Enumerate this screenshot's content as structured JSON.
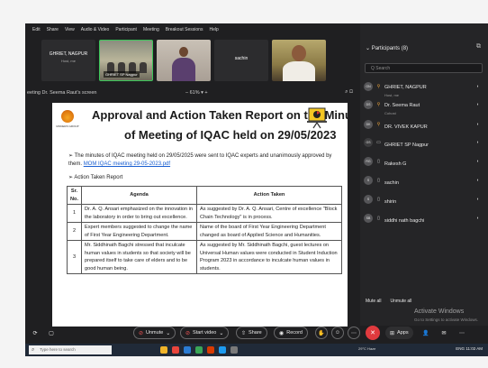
{
  "menu": [
    "Edit",
    "Share",
    "View",
    "Audio & Video",
    "Participant",
    "Meeting",
    "Breakout Sessions",
    "Help"
  ],
  "tiles": [
    {
      "name": "GHRIET, NAGPUR",
      "sub": "Host, me"
    },
    {
      "tag": "GHRIET SP Nagpur"
    },
    {},
    {
      "name": "sachin"
    },
    {}
  ],
  "sharebar": {
    "who": "eeting Dr. Seema Raut's screen",
    "zoom": "61%"
  },
  "document": {
    "logo_text": "MODERN GROUP",
    "title_line1": "Approval and Action Taken Report on the Minutes",
    "title_line2": "of Meeting of IQAC held on 29/05/2023",
    "paragraph": "The minutes of IQAC meeting held on 29/05/2025 were sent to IQAC experts and unanimously approved by them.",
    "link": "MOM IQAC meeting 29-05-2023.pdf",
    "section": "Action Taken Report",
    "table": {
      "headers": [
        "Sr. No.",
        "Agenda",
        "Action Taken"
      ],
      "rows": [
        {
          "no": "1",
          "agenda": "Dr. A. Q. Ansari emphasized on the innovation in the laboratory in order to bring out excellence.",
          "action": "As suggested by Dr. A. Q. Ansari, Centre of excellence \"Block Chain Technology\" is in process."
        },
        {
          "no": "2",
          "agenda": "Expert members suggested to change the name of First Year Engineering Department.",
          "action": "Name of the board of First Year Engineering Department changed as board of Applied Science and Humanities."
        },
        {
          "no": "3",
          "agenda": "Mr. Siddhinath Bagchi stressed that inculcate human values in students so that society will be prepared itself to take care of elders and to be good human being.",
          "action": "As suggested by Mr. Siddhinath Bagchi, guest lectures on Universal Human values were conducted in Student Induction Program 2023 in accordance to inculcate human values in students."
        }
      ]
    }
  },
  "participants": {
    "header": "Participants (8)",
    "search_placeholder": "Q Search",
    "list": [
      {
        "initials": "GN",
        "name": "GHRIET, NAGPUR",
        "sub": "Host, me"
      },
      {
        "initials": "DS",
        "name": "Dr. Seema Raut",
        "sub": "Cohost"
      },
      {
        "initials": "DK",
        "name": "DR. VIVEK KAPUR",
        "sub": ""
      },
      {
        "initials": "GS",
        "name": "GHRIET SP Nagpur",
        "sub": ""
      },
      {
        "initials": "RG",
        "name": "Rakesh G",
        "sub": ""
      },
      {
        "initials": "S",
        "name": "sachin",
        "sub": ""
      },
      {
        "initials": "S",
        "name": "shirin",
        "sub": ""
      },
      {
        "initials": "SB",
        "name": "siddhi nath bagchi",
        "sub": ""
      }
    ],
    "mute_all": "Mute all",
    "unmute_all": "Unmute all"
  },
  "watermark": {
    "line1": "Activate Windows",
    "line2": "Go to Settings to activate Windows."
  },
  "toolbar": {
    "unmute": "Unmute",
    "start_video": "Start video",
    "share": "Share",
    "record": "Record",
    "apps": "Apps"
  },
  "taskbar": {
    "search_placeholder": "Type here to search",
    "weather": "29°C Haze",
    "lang": "ENG",
    "time": "11:02 AM"
  },
  "colors": {
    "accent_red": "#e03a3e",
    "active_speaker": "#3cc65a",
    "link": "#1a5fd1"
  }
}
